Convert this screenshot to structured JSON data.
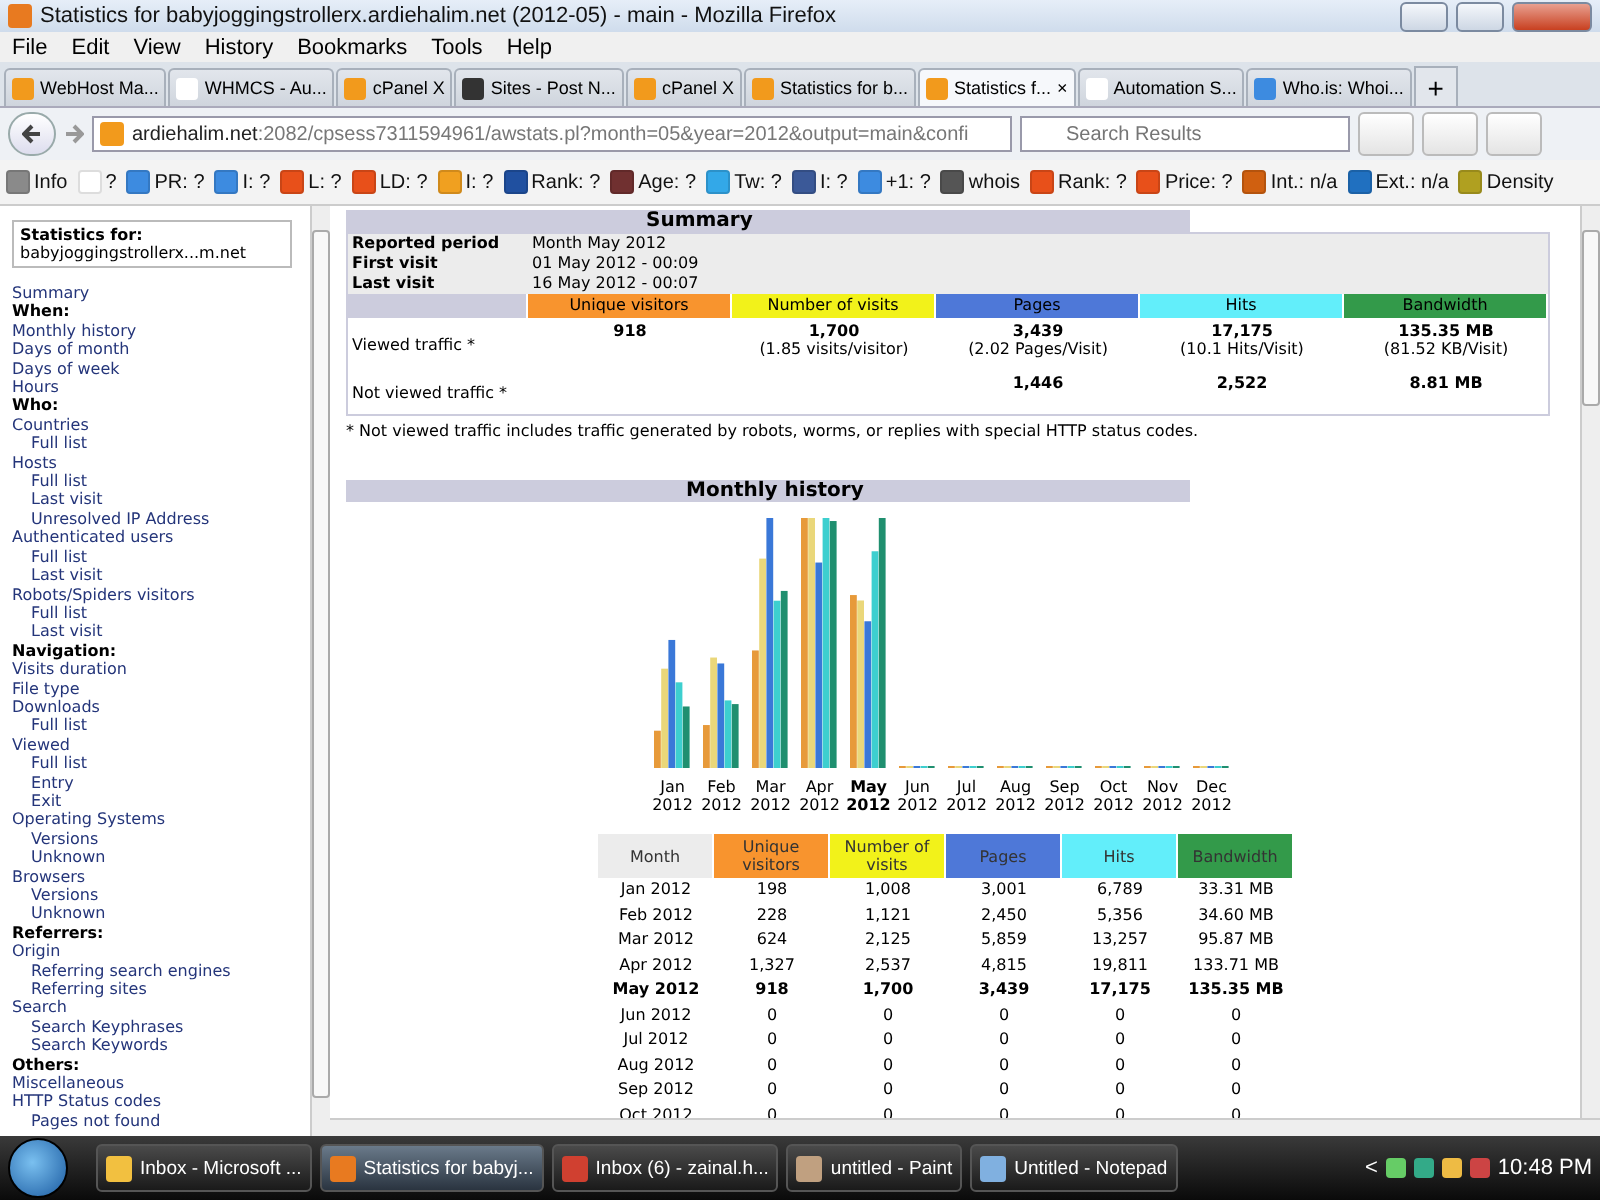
{
  "window": {
    "title": "Statistics for babyjoggingstrollerx.ardiehalim.net (2012-05) - main - Mozilla Firefox"
  },
  "menu": [
    "File",
    "Edit",
    "View",
    "History",
    "Bookmarks",
    "Tools",
    "Help"
  ],
  "tabs": [
    {
      "label": "WebHost Ma...",
      "selected": false
    },
    {
      "label": "WHMCS - Au...",
      "selected": false
    },
    {
      "label": "cPanel X",
      "selected": false
    },
    {
      "label": "Sites - Post N...",
      "selected": false
    },
    {
      "label": "cPanel X",
      "selected": false
    },
    {
      "label": "Statistics for b...",
      "selected": false
    },
    {
      "label": "Statistics f...",
      "selected": true,
      "close": "×"
    },
    {
      "label": "Automation S...",
      "selected": false
    },
    {
      "label": "Who.is: Whoi...",
      "selected": false
    }
  ],
  "new_tab": "+",
  "address": {
    "host": "ardiehalim.net",
    "rest": ":2082/cpsess7311594961/awstats.pl?month=05&year=2012&output=main&confi"
  },
  "search": {
    "placeholder": "Search Results"
  },
  "toolbar_items": [
    {
      "label": "Info",
      "color": "#8a8a8a"
    },
    {
      "label": "?",
      "color": "#ffffff"
    },
    {
      "label": "PR: ?",
      "color": "#3d8be0"
    },
    {
      "label": "I: ?",
      "color": "#3d8be0"
    },
    {
      "label": "L: ?",
      "color": "#e8501a"
    },
    {
      "label": "LD: ?",
      "color": "#e8501a"
    },
    {
      "label": "I: ?",
      "color": "#f0a020"
    },
    {
      "label": "Rank: ?",
      "color": "#2050a0"
    },
    {
      "label": "Age: ?",
      "color": "#703030"
    },
    {
      "label": "Tw: ?",
      "color": "#33a8e8"
    },
    {
      "label": "I: ?",
      "color": "#3b5998"
    },
    {
      "label": "+1: ?",
      "color": "#3d8be0"
    },
    {
      "label": "whois",
      "color": "#555555"
    },
    {
      "label": "Rank: ?",
      "color": "#e8501a"
    },
    {
      "label": "Price: ?",
      "color": "#e8501a"
    },
    {
      "label": "Int.: n/a",
      "color": "#d06010"
    },
    {
      "label": "Ext.: n/a",
      "color": "#2070c0"
    },
    {
      "label": "Density",
      "color": "#b0a020"
    }
  ],
  "sidebar": {
    "title": "Statistics for:",
    "site": "babyjoggingstrollerx...m.net",
    "items": [
      {
        "kind": "link",
        "label": "Summary"
      },
      {
        "kind": "heading",
        "label": "When:"
      },
      {
        "kind": "link",
        "label": "Monthly history"
      },
      {
        "kind": "link",
        "label": "Days of month"
      },
      {
        "kind": "link",
        "label": "Days of week"
      },
      {
        "kind": "link",
        "label": "Hours"
      },
      {
        "kind": "heading",
        "label": "Who:"
      },
      {
        "kind": "link",
        "label": "Countries",
        "children": [
          {
            "label": "Full list"
          }
        ]
      },
      {
        "kind": "link",
        "label": "Hosts",
        "children": [
          {
            "label": "Full list"
          },
          {
            "label": "Last visit"
          },
          {
            "label": "Unresolved IP Address"
          }
        ]
      },
      {
        "kind": "link",
        "label": "Authenticated users",
        "children": [
          {
            "label": "Full list"
          },
          {
            "label": "Last visit"
          }
        ]
      },
      {
        "kind": "link",
        "label": "Robots/Spiders visitors",
        "children": [
          {
            "label": "Full list"
          },
          {
            "label": "Last visit"
          }
        ]
      },
      {
        "kind": "heading",
        "label": "Navigation:"
      },
      {
        "kind": "link",
        "label": "Visits duration"
      },
      {
        "kind": "link",
        "label": "File type"
      },
      {
        "kind": "link",
        "label": "Downloads",
        "children": [
          {
            "label": "Full list"
          }
        ]
      },
      {
        "kind": "link",
        "label": "Viewed",
        "children": [
          {
            "label": "Full list"
          },
          {
            "label": "Entry"
          },
          {
            "label": "Exit"
          }
        ]
      },
      {
        "kind": "link",
        "label": "Operating Systems",
        "children": [
          {
            "label": "Versions"
          },
          {
            "label": "Unknown"
          }
        ]
      },
      {
        "kind": "link",
        "label": "Browsers",
        "children": [
          {
            "label": "Versions"
          },
          {
            "label": "Unknown"
          }
        ]
      },
      {
        "kind": "heading",
        "label": "Referrers:"
      },
      {
        "kind": "link",
        "label": "Origin",
        "children": [
          {
            "label": "Referring search engines"
          },
          {
            "label": "Referring sites"
          }
        ]
      },
      {
        "kind": "link",
        "label": "Search",
        "children": [
          {
            "label": "Search Keyphrases"
          },
          {
            "label": "Search Keywords"
          }
        ]
      },
      {
        "kind": "heading",
        "label": "Others:"
      },
      {
        "kind": "link",
        "label": "Miscellaneous"
      },
      {
        "kind": "link",
        "label": "HTTP Status codes",
        "children": [
          {
            "label": "Pages not found"
          }
        ]
      }
    ]
  },
  "summary": {
    "title": "Summary",
    "info": [
      {
        "label": "Reported period",
        "value": "Month May 2012"
      },
      {
        "label": "First visit",
        "value": "01 May 2012 - 00:09"
      },
      {
        "label": "Last visit",
        "value": "16 May 2012 - 00:07"
      }
    ],
    "columns": [
      {
        "label": "Unique visitors",
        "color": "#f8942e"
      },
      {
        "label": "Number of visits",
        "color": "#f2f21a"
      },
      {
        "label": "Pages",
        "color": "#4e78d8"
      },
      {
        "label": "Hits",
        "color": "#62eefa"
      },
      {
        "label": "Bandwidth",
        "color": "#339a4a"
      }
    ],
    "rows": [
      {
        "label": "Viewed traffic *",
        "cells": [
          {
            "value": "918"
          },
          {
            "value": "1,700",
            "note": "(1.85 visits/visitor)"
          },
          {
            "value": "3,439",
            "note": "(2.02 Pages/Visit)"
          },
          {
            "value": "17,175",
            "note": "(10.1 Hits/Visit)"
          },
          {
            "value": "135.35 MB",
            "note": "(81.52 KB/Visit)"
          }
        ]
      },
      {
        "label": "Not viewed traffic *",
        "cells": [
          {},
          {},
          {
            "value": "1,446"
          },
          {
            "value": "2,522"
          },
          {
            "value": "8.81 MB"
          }
        ]
      }
    ],
    "footnote": "* Not viewed traffic includes traffic generated by robots, worms, or replies with special HTTP status codes."
  },
  "monthly": {
    "title": "Monthly history",
    "chart_months": [
      {
        "month": "Jan",
        "year": "2012",
        "current": false
      },
      {
        "month": "Feb",
        "year": "2012",
        "current": false
      },
      {
        "month": "Mar",
        "year": "2012",
        "current": false
      },
      {
        "month": "Apr",
        "year": "2012",
        "current": false
      },
      {
        "month": "May",
        "year": "2012",
        "current": true
      },
      {
        "month": "Jun",
        "year": "2012",
        "current": false
      },
      {
        "month": "Jul",
        "year": "2012",
        "current": false
      },
      {
        "month": "Aug",
        "year": "2012",
        "current": false
      },
      {
        "month": "Sep",
        "year": "2012",
        "current": false
      },
      {
        "month": "Oct",
        "year": "2012",
        "current": false
      },
      {
        "month": "Nov",
        "year": "2012",
        "current": false
      },
      {
        "month": "Dec",
        "year": "2012",
        "current": false
      }
    ],
    "columns": [
      "Month",
      "Unique visitors",
      "Number of visits",
      "Pages",
      "Hits",
      "Bandwidth"
    ],
    "rows": [
      {
        "current": false,
        "cells": [
          "Jan 2012",
          "198",
          "1,008",
          "3,001",
          "6,789",
          "33.31 MB"
        ]
      },
      {
        "current": false,
        "cells": [
          "Feb 2012",
          "228",
          "1,121",
          "2,450",
          "5,356",
          "34.60 MB"
        ]
      },
      {
        "current": false,
        "cells": [
          "Mar 2012",
          "624",
          "2,125",
          "5,859",
          "13,257",
          "95.87 MB"
        ]
      },
      {
        "current": false,
        "cells": [
          "Apr 2012",
          "1,327",
          "2,537",
          "4,815",
          "19,811",
          "133.71 MB"
        ]
      },
      {
        "current": true,
        "cells": [
          "May 2012",
          "918",
          "1,700",
          "3,439",
          "17,175",
          "135.35 MB"
        ]
      },
      {
        "current": false,
        "cells": [
          "Jun 2012",
          "0",
          "0",
          "0",
          "0",
          "0"
        ]
      },
      {
        "current": false,
        "cells": [
          "Jul 2012",
          "0",
          "0",
          "0",
          "0",
          "0"
        ]
      },
      {
        "current": false,
        "cells": [
          "Aug 2012",
          "0",
          "0",
          "0",
          "0",
          "0"
        ]
      },
      {
        "current": false,
        "cells": [
          "Sep 2012",
          "0",
          "0",
          "0",
          "0",
          "0"
        ]
      },
      {
        "current": false,
        "cells": [
          "Oct 2012",
          "0",
          "0",
          "0",
          "0",
          "0"
        ]
      }
    ]
  },
  "taskbar": {
    "tasks": [
      {
        "label": "Inbox - Microsoft ...",
        "selected": false
      },
      {
        "label": "Statistics for babyj...",
        "selected": true
      },
      {
        "label": "Inbox (6) - zainal.h...",
        "selected": false
      },
      {
        "label": "untitled - Paint",
        "selected": false
      },
      {
        "label": "Untitled - Notepad",
        "selected": false
      }
    ],
    "tray_arrow": "<",
    "clock": "10:48 PM"
  }
}
